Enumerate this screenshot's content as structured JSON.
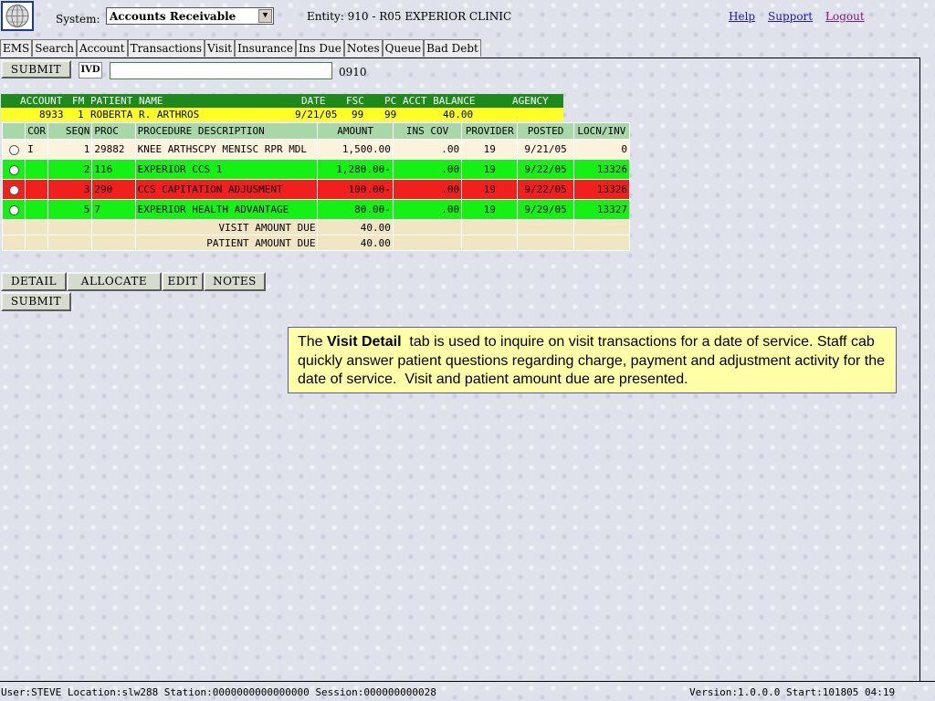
{
  "header": {
    "system_label": "System:",
    "system_value": "Accounts Receivable",
    "entity": "Entity: 910 - R05 EXPERIOR CLINIC",
    "links": {
      "help": "Help",
      "support": "Support",
      "logout": "Logout"
    }
  },
  "tabs": [
    "EMS",
    "Search",
    "Account",
    "Transactions",
    "Visit",
    "Insurance",
    "Ins Due",
    "Notes",
    "Queue",
    "Bad Debt"
  ],
  "toolbar": {
    "submit_label": "SUBMIT",
    "ivd_label": "IVD",
    "input_value": "",
    "input_suffix": "0910"
  },
  "account": {
    "headers": {
      "account": "ACCOUNT",
      "fm": "FM",
      "patient_name": "PATIENT NAME",
      "date": "DATE",
      "fsc": "FSC",
      "pc": "PC",
      "acct_balance": "ACCT BALANCE",
      "agency": "AGENCY"
    },
    "row": {
      "account": "8933",
      "fm": "1",
      "patient_name": "ROBERTA R. ARTHROS",
      "date": "9/21/05",
      "fsc": "99",
      "pc": "99",
      "acct_balance": "40.00",
      "agency": ""
    }
  },
  "transactions": {
    "columns": [
      "",
      "COR",
      "SEQN",
      "PROC",
      "PROCEDURE DESCRIPTION",
      "AMOUNT",
      "INS COV",
      "PROVIDER",
      "POSTED",
      "LOCN/INV"
    ],
    "rows": [
      {
        "style": "white",
        "cor": "I",
        "seqn": "1",
        "proc": "29882",
        "desc": "KNEE ARTHSCPY MENISC RPR MDL",
        "amount": "1,500.00",
        "ins_cov": "",
        "provider": "19",
        "posted": "9/21/05",
        "locn": "0"
      },
      {
        "style": "green",
        "cor": "",
        "seqn": "2",
        "proc": "116",
        "desc": "EXPERIOR CCS 1",
        "amount": "1,280.00-",
        "ins_cov": ".00",
        "provider": "19",
        "posted": "9/22/05",
        "locn": "13326"
      },
      {
        "style": "red",
        "cor": "",
        "seqn": "3",
        "proc": "290",
        "desc": "CCS CAPITATION ADJUSMENT",
        "amount": "100.00-",
        "ins_cov": ".00",
        "provider": "19",
        "posted": "9/22/05",
        "locn": "13326"
      },
      {
        "style": "green",
        "cor": "",
        "seqn": "5",
        "proc": "7",
        "desc": "EXPERIOR HEALTH ADVANTAGE",
        "amount": "80.00-",
        "ins_cov": ".00",
        "provider": "19",
        "posted": "9/29/05",
        "locn": "13327"
      }
    ],
    "ins_cov_first": ".00",
    "summary": [
      {
        "label": "VISIT AMOUNT DUE",
        "value": "40.00"
      },
      {
        "label": "PATIENT AMOUNT DUE",
        "value": "40.00"
      }
    ]
  },
  "actions": {
    "detail": "DETAIL",
    "allocate": "ALLOCATE",
    "edit": "EDIT",
    "notes": "NOTES",
    "submit": "SUBMIT"
  },
  "note": {
    "prefix": "The ",
    "bold": "Visit Detail",
    "text": "  tab is used to inquire on visit transactions for a date of service. Staff cab quickly answer patient questions regarding charge, payment and adjustment activity for the date of service.  Visit and patient amount due are presented."
  },
  "status": {
    "left": "User:STEVE Location:slw288 Station:0000000000000000 Session:000000000028",
    "right": "Version:1.0.0.0  Start:101805 04:19"
  },
  "colors": {
    "account_header": "#1e8a1e",
    "account_row": "#ffff26",
    "green_row": "#15f015",
    "red_row": "#f21f1f",
    "note_bg": "#ffffa8"
  }
}
